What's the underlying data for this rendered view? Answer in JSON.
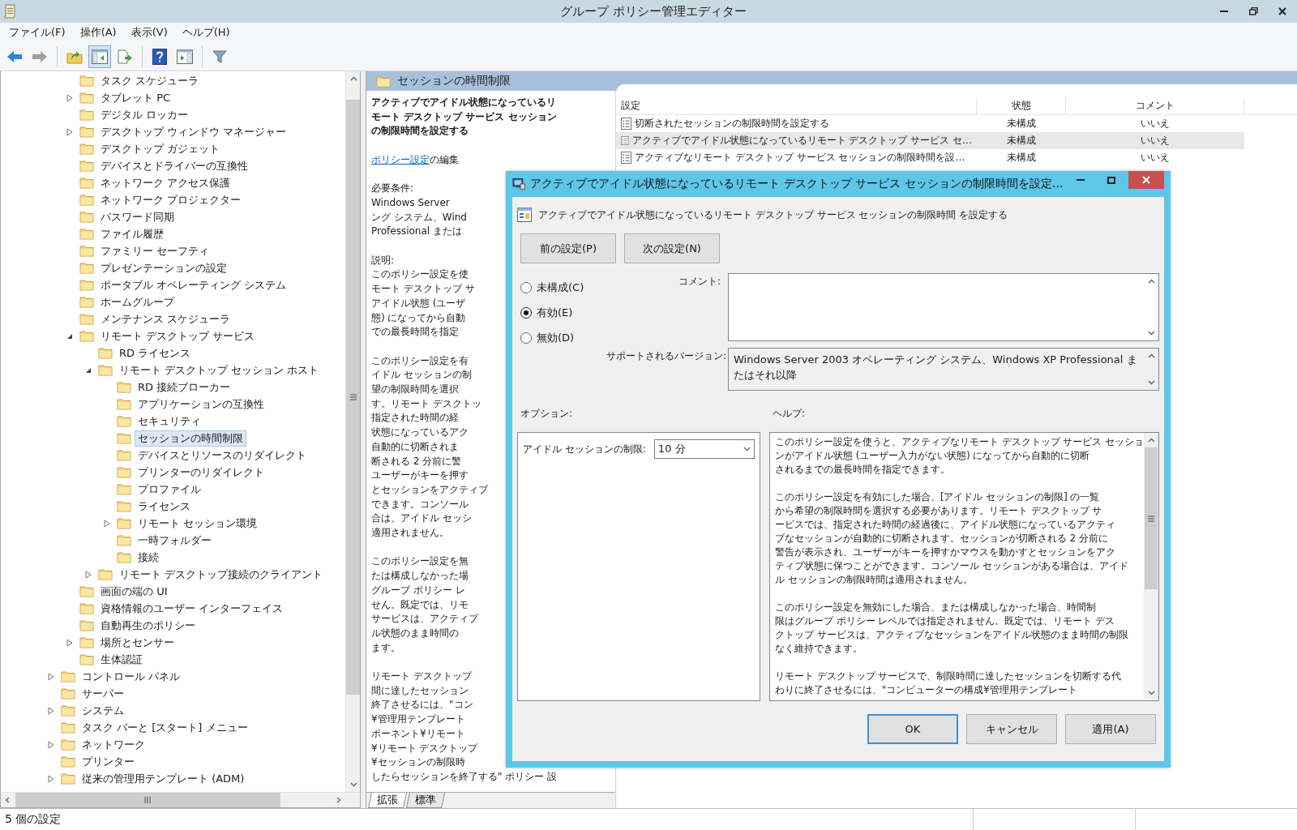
{
  "window": {
    "title": "グループ ポリシー管理エディター"
  },
  "menu": [
    "ファイル(F)",
    "操作(A)",
    "表示(V)",
    "ヘルプ(H)"
  ],
  "toolbar_groups": [
    [
      {
        "kind": "back",
        "on": false,
        "disabled": false
      },
      {
        "kind": "forward",
        "on": false,
        "disabled": true
      }
    ],
    [
      {
        "kind": "up",
        "on": false,
        "disabled": false
      },
      {
        "kind": "tree_toggle",
        "on": true,
        "disabled": false
      },
      {
        "kind": "export",
        "on": false,
        "disabled": false
      }
    ],
    [
      {
        "kind": "help",
        "on": false,
        "disabled": false
      },
      {
        "kind": "action_pane",
        "on": false,
        "disabled": false
      }
    ],
    [
      {
        "kind": "filter",
        "on": false,
        "disabled": false
      }
    ]
  ],
  "tree": {
    "items": [
      {
        "label": "タスク スケジューラ",
        "kind": "leaf",
        "selected": false
      },
      {
        "label": "タブレット PC",
        "kind": "collapsed",
        "selected": false
      },
      {
        "label": "デジタル ロッカー",
        "kind": "leaf",
        "selected": false
      },
      {
        "label": "デスクトップ ウィンドウ マネージャー",
        "kind": "collapsed",
        "selected": false
      },
      {
        "label": "デスクトップ ガジェット",
        "kind": "leaf",
        "selected": false
      },
      {
        "label": "デバイスとドライバーの互換性",
        "kind": "leaf",
        "selected": false
      },
      {
        "label": "ネットワーク アクセス保護",
        "kind": "leaf",
        "selected": false
      },
      {
        "label": "ネットワーク プロジェクター",
        "kind": "leaf",
        "selected": false
      },
      {
        "label": "パスワード同期",
        "kind": "leaf",
        "selected": false
      },
      {
        "label": "ファイル履歴",
        "kind": "leaf",
        "selected": false
      },
      {
        "label": "ファミリー セーフティ",
        "kind": "leaf",
        "selected": false
      },
      {
        "label": "プレゼンテーションの設定",
        "kind": "leaf",
        "selected": false
      },
      {
        "label": "ポータブル オペレーティング システム",
        "kind": "leaf",
        "selected": false
      },
      {
        "label": "ホームグループ",
        "kind": "leaf",
        "selected": false
      },
      {
        "label": "メンテナンス スケジューラ",
        "kind": "leaf",
        "selected": false
      },
      {
        "label": "リモート デスクトップ サービス",
        "kind": "expanded",
        "selected": false,
        "children": [
          {
            "label": "RD ライセンス",
            "kind": "leaf",
            "selected": false
          },
          {
            "label": "リモート デスクトップ セッション ホスト",
            "kind": "expanded",
            "selected": false,
            "children": [
              {
                "label": "RD 接続ブローカー",
                "kind": "leaf",
                "selected": false
              },
              {
                "label": "アプリケーションの互換性",
                "kind": "leaf",
                "selected": false
              },
              {
                "label": "セキュリティ",
                "kind": "leaf",
                "selected": false
              },
              {
                "label": "セッションの時間制限",
                "kind": "leaf",
                "selected": true
              },
              {
                "label": "デバイスとリソースのリダイレクト",
                "kind": "leaf",
                "selected": false
              },
              {
                "label": "プリンターのリダイレクト",
                "kind": "leaf",
                "selected": false
              },
              {
                "label": "プロファイル",
                "kind": "leaf",
                "selected": false
              },
              {
                "label": "ライセンス",
                "kind": "leaf",
                "selected": false
              },
              {
                "label": "リモート セッション環境",
                "kind": "collapsed",
                "selected": false
              },
              {
                "label": "一時フォルダー",
                "kind": "leaf",
                "selected": false
              },
              {
                "label": "接続",
                "kind": "leaf",
                "selected": false
              }
            ]
          },
          {
            "label": "リモート デスクトップ接続のクライアント",
            "kind": "collapsed",
            "selected": false
          }
        ]
      },
      {
        "label": "画面の端の UI",
        "kind": "leaf",
        "selected": false
      },
      {
        "label": "資格情報のユーザー インターフェイス",
        "kind": "leaf",
        "selected": false
      },
      {
        "label": "自動再生のポリシー",
        "kind": "leaf",
        "selected": false
      },
      {
        "label": "場所とセンサー",
        "kind": "collapsed",
        "selected": false
      },
      {
        "label": "生体認証",
        "kind": "leaf",
        "selected": false
      }
    ],
    "outer_items": [
      {
        "label": "コントロール パネル",
        "kind": "collapsed",
        "selected": false
      },
      {
        "label": "サーバー",
        "kind": "leaf",
        "selected": false
      },
      {
        "label": "システム",
        "kind": "collapsed",
        "selected": false
      },
      {
        "label": "タスク バーと [スタート] メニュー",
        "kind": "leaf",
        "selected": false
      },
      {
        "label": "ネットワーク",
        "kind": "collapsed",
        "selected": false
      },
      {
        "label": "プリンター",
        "kind": "leaf",
        "selected": false
      },
      {
        "label": "従来の管理用テンプレート (ADM)",
        "kind": "collapsed",
        "selected": false
      }
    ]
  },
  "details": {
    "header": "セッションの時間制限",
    "title": "アクティブでアイドル状態になっているリモート デスクトップ サービス セッションの制限時間を設定する",
    "edit_link": "ポリシー設定",
    "edit_suffix": "の編集",
    "blocks": [
      [
        "必要条件:",
        "Windows Server",
        "ング システム、Wind",
        "Professional または"
      ],
      [
        "説明:",
        "このポリシー設定を使",
        "モート デスクトップ サ",
        "アイドル状態 (ユーザ",
        "態) になってから自動",
        "での最長時間を指定"
      ],
      [
        "このポリシー設定を有",
        "イドル セッションの制",
        "望の制限時間を選択",
        "す。リモート デスクトッ",
        "指定された時間の経",
        "状態になっているアク",
        "自動的に切断されま",
        "断される 2 分前に警",
        "ユーザーがキーを押す",
        "とセッションをアクティブ",
        "できます。コンソール",
        "合は、アイドル セッシ",
        "適用されません。"
      ],
      [
        "このポリシー設定を無",
        "たは構成しなかった場",
        "グループ ポリシー レ",
        "せん。既定では、リモ",
        "サービスは、アクティブ",
        "ル状態のまま時間の",
        "ます。"
      ],
      [
        "リモート デスクトップ",
        "間に達したセッション",
        "終了させるには、\"コン",
        "¥管理用テンプレート",
        "ポーネント¥リモート",
        "¥リモート デスクトップ",
        "¥セッションの制限時",
        "したらセッションを終了する\" ポリシー 設"
      ]
    ],
    "tabs": [
      {
        "label": "拡張",
        "selected": true
      },
      {
        "label": "標準",
        "selected": false
      }
    ]
  },
  "settings": {
    "columns": [
      "設定",
      "状態",
      "コメント"
    ],
    "rows": [
      {
        "name": "切断されたセッションの制限時間を設定する",
        "state": "未構成",
        "comment": "いいえ",
        "selected": false
      },
      {
        "name": "アクティブでアイドル状態になっているリモート デスクトップ サービス セ…",
        "state": "未構成",
        "comment": "いいえ",
        "selected": true
      },
      {
        "name": "アクティブなリモート デスクトップ サービス セッションの制限時間を設…",
        "state": "未構成",
        "comment": "いいえ",
        "selected": false
      }
    ]
  },
  "dialog": {
    "title": "アクティブでアイドル状態になっているリモート デスクトップ サービス セッションの制限時間を設定…",
    "policy_name": "アクティブでアイドル状態になっているリモート デスクトップ サービス セッションの制限時間 を設定する",
    "nav_buttons": [
      "前の設定(P)",
      "次の設定(N)"
    ],
    "radios": [
      {
        "label": "未構成(C)",
        "selected": false
      },
      {
        "label": "有効(E)",
        "selected": true
      },
      {
        "label": "無効(D)",
        "selected": false
      }
    ],
    "comment_label": "コメント:",
    "supported_label": "サポートされるバージョン:",
    "supported": "Windows Server 2003 オペレーティング システム、Windows XP Professional またはそれ以降",
    "options_label": "オプション:",
    "help_label": "ヘルプ:",
    "option": {
      "label": "アイドル セッションの制限:",
      "value": "10 分"
    },
    "help": [
      [
        "このポリシー設定を使うと、アクティブなリモート デスクトップ サービス セッショ",
        "ンがアイドル状態 (ユーザー入力がない状態) になってから自動的に切断",
        "されるまでの最長時間を指定できます。"
      ],
      [
        "このポリシー設定を有効にした場合、[アイドル セッションの制限] の一覧",
        "から希望の制限時間を選択する必要があります。リモート デスクトップ サ",
        "ービスでは、指定された時間の経過後に、アイドル状態になっているアクティ",
        "ブなセッションが自動的に切断されます。セッションが切断される 2 分前に",
        "警告が表示され、ユーザーがキーを押すかマウスを動かすとセッションをアク",
        "ティブ状態に保つことができます。コンソール セッションがある場合は、アイド",
        "ル セッションの制限時間は適用されません。"
      ],
      [
        "このポリシー設定を無効にした場合、または構成しなかった場合、時間制",
        "限はグループ ポリシー レベルでは指定されません。既定では、リモート デス",
        "クトップ サービスは、アクティブなセッションをアイドル状態のまま時間の制限",
        "なく維持できます。"
      ],
      [
        "リモート デスクトップ サービスで、制限時間に達したセッションを切断する代",
        "わりに終了させるには、\"コンピューターの構成¥管理用テンプレート"
      ]
    ],
    "buttons": [
      {
        "label": "OK",
        "default": true
      },
      {
        "label": "キャンセル",
        "default": false
      },
      {
        "label": "適用(A)",
        "default": false
      }
    ]
  },
  "status_bar": "5 個の設定"
}
